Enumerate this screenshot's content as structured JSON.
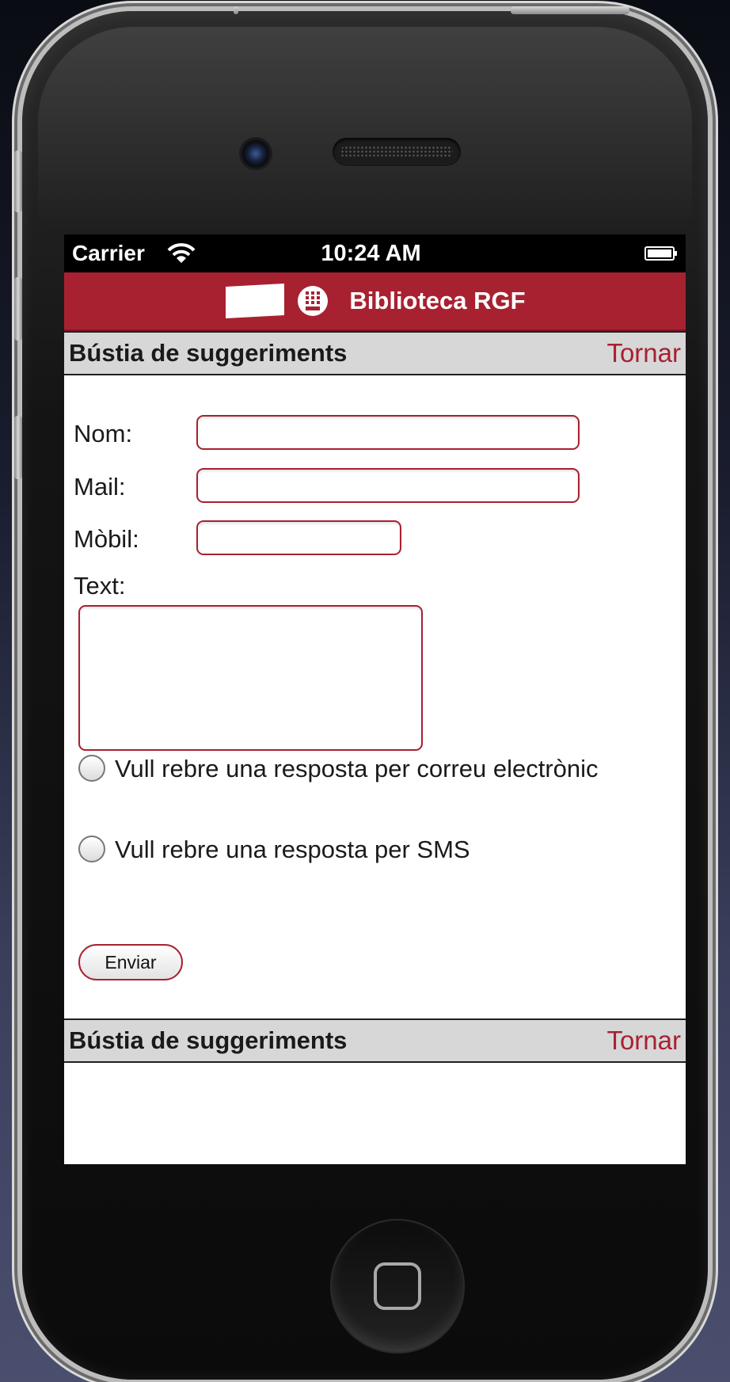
{
  "status_bar": {
    "carrier": "Carrier",
    "time": "10:24 AM",
    "wifi_icon": "wifi-icon",
    "battery_icon": "battery-icon"
  },
  "navbar": {
    "title": "Biblioteca RGF",
    "logo_icons": [
      "flag-logo-icon",
      "upc-logo-icon"
    ],
    "color": "#a82131"
  },
  "section": {
    "title": "Bústia de suggeriments",
    "back_label": "Tornar"
  },
  "form": {
    "name_label": "Nom:",
    "name_value": "",
    "mail_label": "Mail:",
    "mail_value": "",
    "mobile_label": "Mòbil:",
    "mobile_value": "",
    "text_label": "Text:",
    "text_value": "",
    "email_reply_label": "Vull rebre una resposta per correu electrònic",
    "email_reply_checked": false,
    "sms_reply_label": "Vull rebre una resposta per SMS",
    "sms_reply_checked": false,
    "submit_label": "Enviar"
  },
  "footer_section": {
    "title": "Bústia de suggeriments",
    "back_label": "Tornar"
  }
}
